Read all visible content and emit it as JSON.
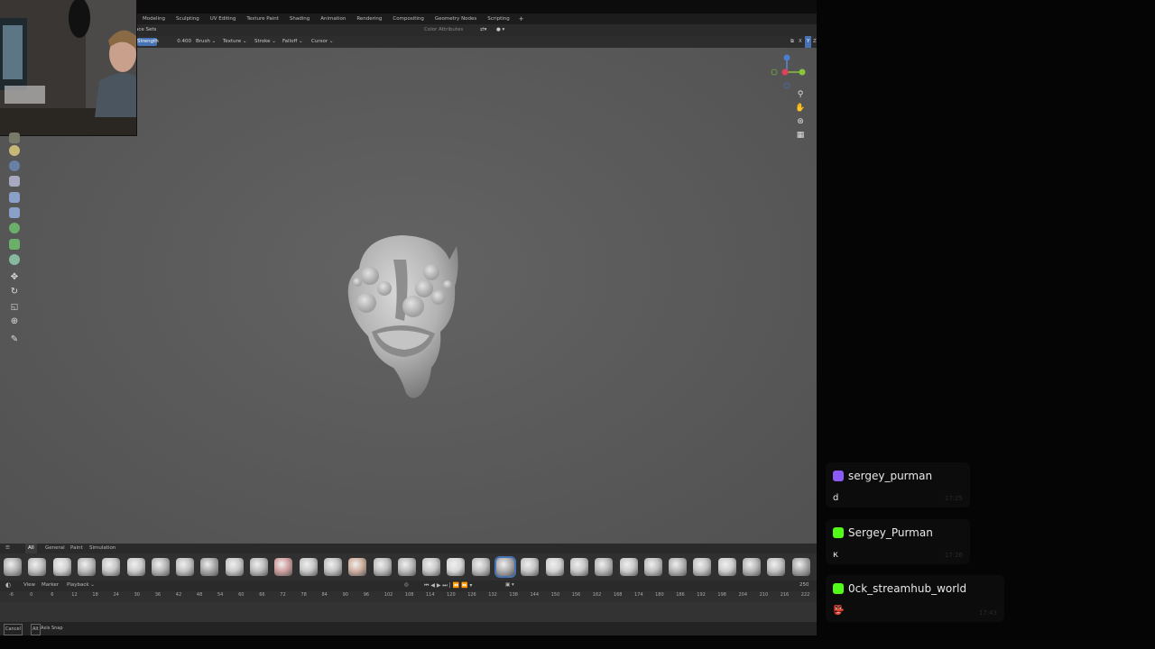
{
  "workspaces": {
    "tabs": [
      "Modeling",
      "Sculpting",
      "UV Editing",
      "Texture Paint",
      "Shading",
      "Animation",
      "Rendering",
      "Compositing",
      "Geometry Nodes",
      "Scripting"
    ],
    "add_label": "+"
  },
  "header1": {
    "left_label": "ace Sets",
    "color_attributes": "Color Attributes"
  },
  "header2": {
    "strength_label": "Strength",
    "strength_value": "0.400",
    "brush": "Brush",
    "texture": "Texture",
    "stroke": "Stroke",
    "falloff": "Falloff",
    "cursor": "Cursor",
    "axis_labels": [
      "X",
      "Y",
      "Z"
    ]
  },
  "asset_shelf": {
    "tabs": [
      "All",
      "General",
      "Paint",
      "Simulation"
    ]
  },
  "timeline": {
    "menu": [
      "View",
      "Marker",
      "Playback"
    ],
    "end_frame": "250",
    "ticks": [
      "-6",
      "0",
      "6",
      "12",
      "18",
      "24",
      "30",
      "36",
      "42",
      "48",
      "54",
      "60",
      "66",
      "72",
      "78",
      "84",
      "90",
      "96",
      "102",
      "108",
      "114",
      "120",
      "126",
      "132",
      "138",
      "144",
      "150",
      "156",
      "162",
      "168",
      "174",
      "180",
      "186",
      "192",
      "198",
      "204",
      "210",
      "216",
      "222"
    ]
  },
  "statusbar": {
    "cancel": "Cancel",
    "axis_snap_key": "Alt",
    "axis_snap": "Axis Snap"
  },
  "chat": {
    "messages": [
      {
        "platform": "twitch",
        "username": "sergey_purman",
        "text": "d",
        "time": "17:25",
        "color": "#8a5cf5"
      },
      {
        "platform": "kick",
        "username": "Sergey_Purman",
        "text": "к",
        "time": "17:26",
        "color": "#53fc18"
      },
      {
        "platform": "kick",
        "username": "0ck_streamhub_world",
        "text": "👺",
        "time": "17:43",
        "color": "#53fc18"
      }
    ]
  }
}
